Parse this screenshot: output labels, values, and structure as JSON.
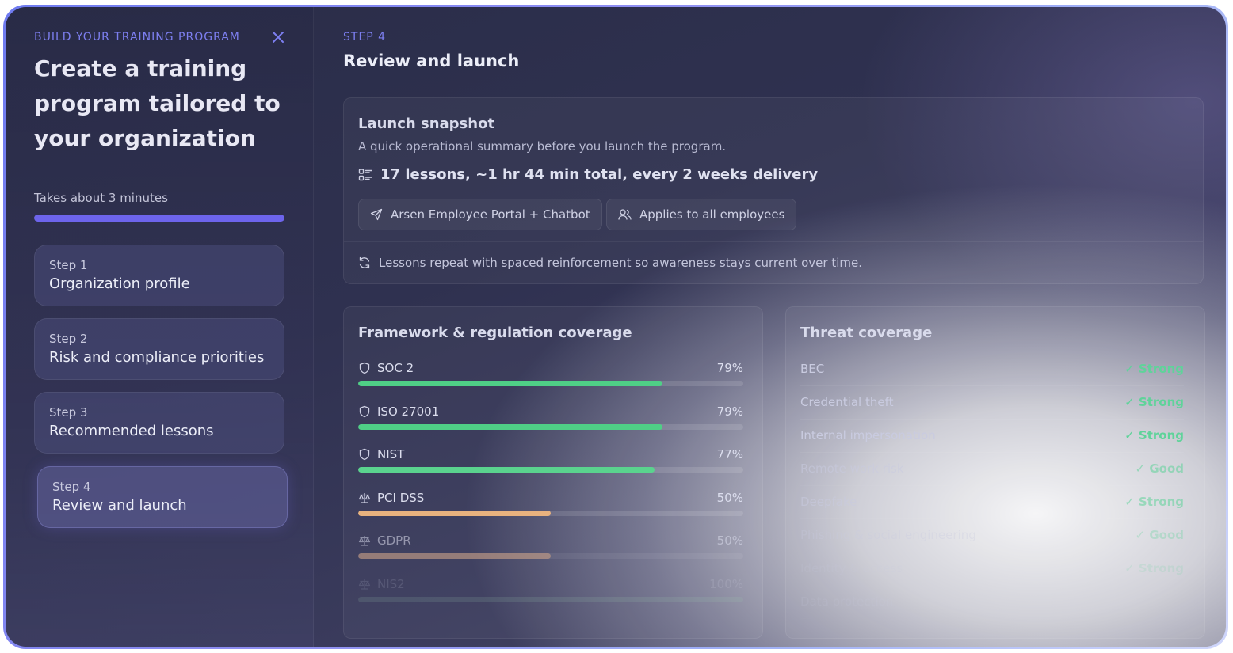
{
  "sidebar": {
    "eyebrow": "BUILD YOUR TRAINING PROGRAM",
    "title": "Create a training program tailored to your organization",
    "duration": "Takes about 3 minutes",
    "progress": 1.0,
    "steps": [
      {
        "num": "Step 1",
        "name": "Organization profile"
      },
      {
        "num": "Step 2",
        "name": "Risk and compliance priorities"
      },
      {
        "num": "Step 3",
        "name": "Recommended lessons"
      },
      {
        "num": "Step 4",
        "name": "Review and launch"
      }
    ],
    "active_step": 4
  },
  "main": {
    "eyebrow": "STEP 4",
    "title": "Review and launch",
    "snapshot": {
      "title": "Launch snapshot",
      "subtitle": "A quick operational summary before you launch the program.",
      "summary": "17 lessons, ~1 hr 44 min total, every 2 weeks delivery",
      "channel": "Arsen Employee Portal + Chatbot",
      "audience": "Applies to all employees",
      "note": "Lessons repeat with spaced reinforcement so awareness stays current over time."
    },
    "frameworks": {
      "title": "Framework & regulation coverage",
      "items": [
        {
          "name": "SOC 2",
          "pct": "79%",
          "value": 0.79,
          "icon": "shield-icon",
          "color": "#4fcf86"
        },
        {
          "name": "ISO 27001",
          "pct": "79%",
          "value": 0.79,
          "icon": "shield-icon",
          "color": "#4fcf86"
        },
        {
          "name": "NIST",
          "pct": "77%",
          "value": 0.77,
          "icon": "shield-icon",
          "color": "#5ad38e"
        },
        {
          "name": "PCI DSS",
          "pct": "50%",
          "value": 0.5,
          "icon": "scale-icon",
          "color": "#e8b27e"
        },
        {
          "name": "GDPR",
          "pct": "50%",
          "value": 0.5,
          "icon": "scale-icon",
          "color": "#dcae8e"
        },
        {
          "name": "NIS2",
          "pct": "100%",
          "value": 1.0,
          "icon": "scale-icon",
          "color": "#9fcfb2"
        }
      ]
    },
    "threats": {
      "title": "Threat coverage",
      "items": [
        {
          "name": "BEC",
          "status": "✓ Strong"
        },
        {
          "name": "Credential theft",
          "status": "✓ Strong"
        },
        {
          "name": "Internal impersonation",
          "status": "✓ Strong"
        },
        {
          "name": "Remote work risk",
          "status": "✓ Good"
        },
        {
          "name": "Deepfake",
          "status": "✓ Strong"
        },
        {
          "name": "Phishing & social engineering",
          "status": "✓ Good"
        },
        {
          "name": "Identity & access",
          "status": "✓ Strong"
        },
        {
          "name": "Data protection",
          "status": ""
        }
      ]
    }
  },
  "colors": {
    "accent": "#6d64ec",
    "strong": "#5fd39a"
  }
}
